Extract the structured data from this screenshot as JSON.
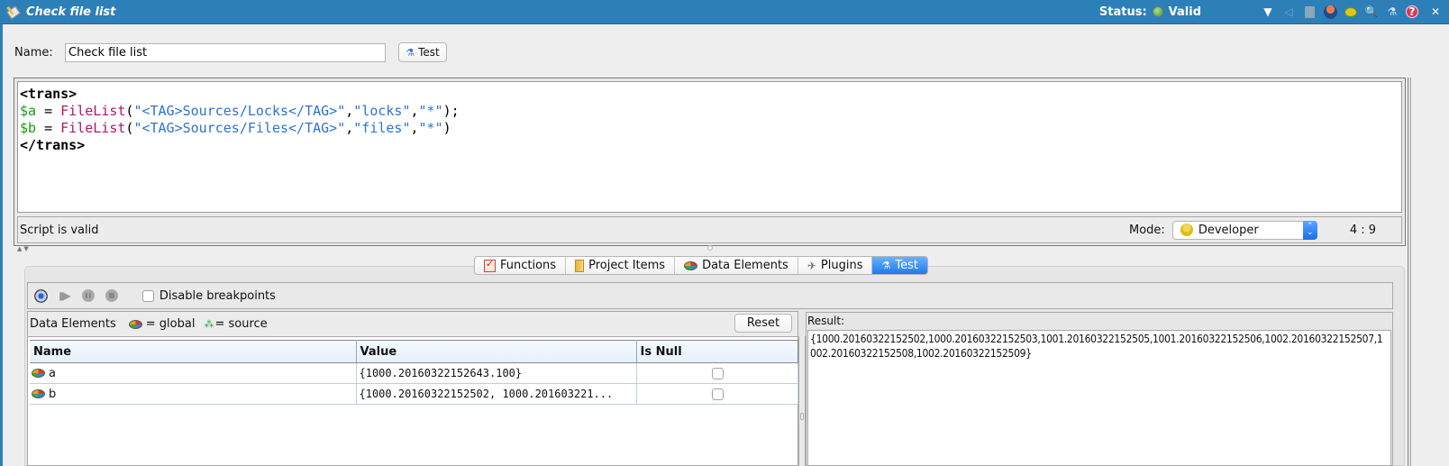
{
  "window": {
    "title": "Check file list",
    "status_label": "Status:",
    "status_value": "Valid",
    "status_color": "#3d9b2a",
    "toolbar_icons": [
      "dropdown-arrow-icon",
      "share-icon",
      "save-icon",
      "deploy-icon",
      "planet-icon",
      "search-icon",
      "test-icon",
      "help-icon",
      "close-icon"
    ],
    "toolbar_glyphs": {
      "dropdown": "▼",
      "share": "◁",
      "search": "🔍",
      "test": "⚗",
      "help": "?",
      "close": "✕"
    }
  },
  "name_row": {
    "label": "Name:",
    "value": "Check file list",
    "test_button": "Test",
    "test_glyph": "⚗"
  },
  "editor": {
    "lines": [
      [
        {
          "t": "<trans>",
          "c": "kw"
        }
      ],
      [
        {
          "t": "$a",
          "c": "var"
        },
        {
          "t": " = ",
          "c": "pun"
        },
        {
          "t": "FileList",
          "c": "fn"
        },
        {
          "t": "(",
          "c": "pun"
        },
        {
          "t": "\"<TAG>Sources/Locks</TAG>\"",
          "c": "str"
        },
        {
          "t": ",",
          "c": "pun"
        },
        {
          "t": "\"locks\"",
          "c": "str"
        },
        {
          "t": ",",
          "c": "pun"
        },
        {
          "t": "\"*\"",
          "c": "str"
        },
        {
          "t": ");",
          "c": "pun"
        }
      ],
      [
        {
          "t": "$b",
          "c": "var"
        },
        {
          "t": " = ",
          "c": "pun"
        },
        {
          "t": "FileList",
          "c": "fn"
        },
        {
          "t": "(",
          "c": "pun"
        },
        {
          "t": "\"<TAG>Sources/Files</TAG>\"",
          "c": "str"
        },
        {
          "t": ",",
          "c": "pun"
        },
        {
          "t": "\"files\"",
          "c": "str"
        },
        {
          "t": ",",
          "c": "pun"
        },
        {
          "t": "\"*\"",
          "c": "str"
        },
        {
          "t": ")",
          "c": "pun"
        }
      ],
      [
        {
          "t": "</trans>",
          "c": "kw"
        }
      ]
    ],
    "status": "Script is valid",
    "mode_label": "Mode:",
    "mode_value": "Developer",
    "cursor_position": "4 : 9"
  },
  "splitter": {
    "arrows": "▲▼"
  },
  "tabs": [
    {
      "label": "Functions",
      "icon": "functions-icon",
      "active": false
    },
    {
      "label": "Project Items",
      "icon": "project-items-icon",
      "active": false
    },
    {
      "label": "Data Elements",
      "icon": "data-elements-icon",
      "active": false
    },
    {
      "label": "Plugins",
      "icon": "plugins-icon",
      "active": false
    },
    {
      "label": "Test",
      "icon": "test-icon",
      "active": true
    }
  ],
  "tab_glyphs": {
    "plugins": "✈",
    "test": "⚗"
  },
  "debug": {
    "step_glyph": "▮▶",
    "disable_breakpoints_label": "Disable breakpoints",
    "disable_breakpoints_checked": false
  },
  "data_elements": {
    "title": "Data Elements",
    "legend_global": "= global",
    "legend_source": "= source",
    "source_glyph": "⁂",
    "reset_button": "Reset",
    "columns": [
      "Name",
      "Value",
      "Is Null"
    ],
    "rows": [
      {
        "name": "a",
        "value": "{1000.20160322152643.100}",
        "is_null": false
      },
      {
        "name": "b",
        "value": "{1000.20160322152502, 1000.201603221...",
        "is_null": false
      }
    ]
  },
  "result": {
    "label": "Result:",
    "value": "{1000.20160322152502,1000.20160322152503,1001.20160322152505,1001.20160322152506,1002.20160322152507,1002.20160322152508,1002.20160322152509}"
  }
}
